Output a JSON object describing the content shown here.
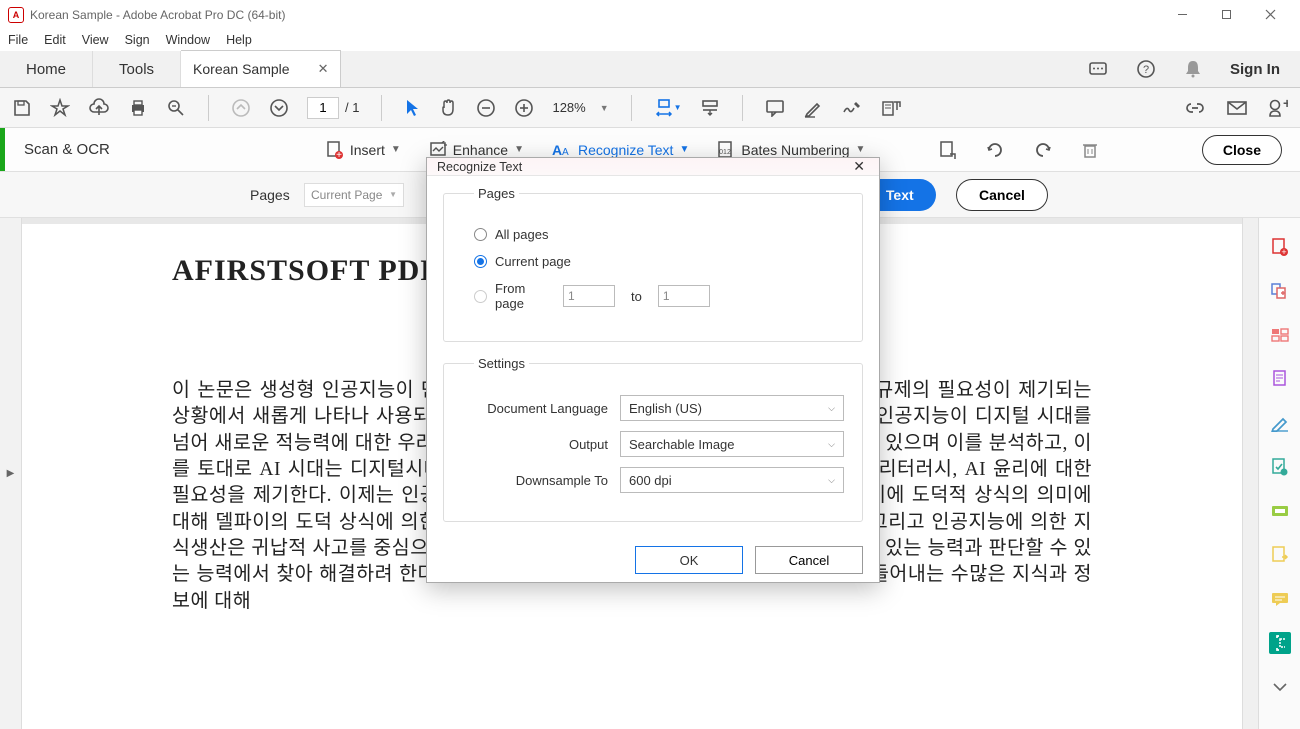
{
  "window": {
    "title": "Korean Sample - Adobe Acrobat Pro DC (64-bit)"
  },
  "menu": {
    "file": "File",
    "edit": "Edit",
    "view": "View",
    "sign": "Sign",
    "window": "Window",
    "help": "Help"
  },
  "tabs": {
    "home": "Home",
    "tools": "Tools",
    "doc": "Korean Sample",
    "signin": "Sign In"
  },
  "toolbar": {
    "page_current": "1",
    "page_total": "/  1",
    "zoom": "128%"
  },
  "scanbar": {
    "title": "Scan & OCR",
    "insert": "Insert",
    "enhance": "Enhance",
    "recognize": "Recognize Text",
    "bates": "Bates Numbering",
    "close": "Close"
  },
  "pagesbar": {
    "label": "Pages",
    "select": "Current Page",
    "primary": "Recognize Text",
    "cancel": "Cancel"
  },
  "document": {
    "heading": "AFIRSTSOFT PDF",
    "body": "이 논문은 생성형 인공지능이 만들어내는 수많은 지식과 정보에 대해 능성과 윤리적 규제의 필요성이 제기되는 상황에서 새롭게 나타나 사용되고 있는 기준의 필요성에 대해 분석하고 있다. 생성형 인공지능이 디지털 시대를 넘어 새로운 적능력에 대한 우려가 늘어나며 이것이 디지털 시대를 넘어 새로운 국면이 있으며 이를 분석하고, 이를 토대로 AI 시대는 디지털시대를 넘어 새로운 국면이 있으며 이는 AI 시민성과 AI 리터러시, AI 윤리에 대한 필요성을 제기한다. 이제는 인공지능이 새로운 지식생산의 주체중 하나로 들어가면 이에 도덕적 상식의 의미에 대해 델파이의 도덕 상식에 의한 추론을 통해 다시 한번 생각할 수 있게 설명하였다. 그리고 인공지능에 의한 지식생산은 귀납적 사고를 중심으로 하는 경향이 있으며 여기서 나타나는 문제를 물을 수 있는 능력과 판단할 수 있는 능력에서 찾아 해결하려 한다. 새롭게 나타나 사용되고 있는 생성형 인공지능이 만들어내는 수많은 지식과 정보에 대해"
  },
  "dialog": {
    "title": "Recognize Text",
    "pages_legend": "Pages",
    "all_pages": "All pages",
    "current_page": "Current page",
    "from_page": "From page",
    "from_val": "1",
    "to": "to",
    "to_val": "1",
    "settings_legend": "Settings",
    "doc_lang_label": "Document Language",
    "doc_lang_value": "English (US)",
    "output_label": "Output",
    "output_value": "Searchable Image",
    "downsample_label": "Downsample To",
    "downsample_value": "600 dpi",
    "ok": "OK",
    "cancel": "Cancel"
  }
}
